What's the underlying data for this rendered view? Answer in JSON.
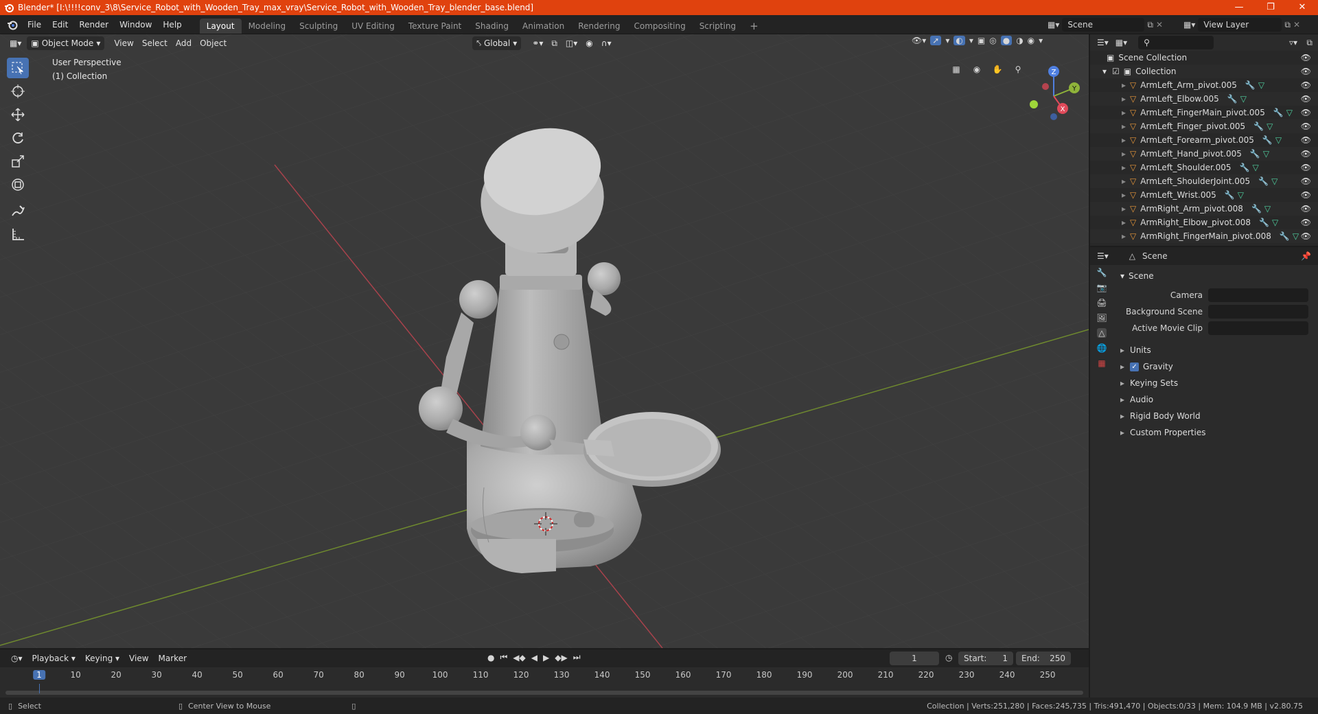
{
  "titlebar": {
    "title": "Blender* [I:\\!!!!conv_3\\8\\Service_Robot_with_Wooden_Tray_max_vray\\Service_Robot_with_Wooden_Tray_blender_base.blend]",
    "controls": [
      "minimize-icon",
      "maximize-icon",
      "close-icon"
    ]
  },
  "topbar": {
    "menus": [
      "File",
      "Edit",
      "Render",
      "Window",
      "Help"
    ],
    "workspaces": [
      "Layout",
      "Modeling",
      "Sculpting",
      "UV Editing",
      "Texture Paint",
      "Shading",
      "Animation",
      "Rendering",
      "Compositing",
      "Scripting"
    ],
    "active_workspace": "Layout",
    "scene": "Scene",
    "view_layer": "View Layer"
  },
  "viewport": {
    "mode": "Object Mode",
    "menus": [
      "View",
      "Select",
      "Add",
      "Object"
    ],
    "transform_orientation": "Global",
    "perspective_label": "User Perspective",
    "collection_label": "(1) Collection",
    "gizmo_axes": [
      "Z",
      "Y",
      "X"
    ],
    "tools": [
      "select-box-icon",
      "cursor-icon",
      "move-icon",
      "rotate-icon",
      "scale-icon",
      "transform-icon",
      "annotate-icon",
      "measure-icon"
    ],
    "colors": {
      "x_axis": "#e04a5a",
      "y_axis": "#8fb33a",
      "z_axis": "#4f7fe0",
      "accent": "#4772b3"
    }
  },
  "outliner": {
    "root": "Scene Collection",
    "collection": "Collection",
    "items": [
      "ArmLeft_Arm_pivot.005",
      "ArmLeft_Elbow.005",
      "ArmLeft_FingerMain_pivot.005",
      "ArmLeft_Finger_pivot.005",
      "ArmLeft_Forearm_pivot.005",
      "ArmLeft_Hand_pivot.005",
      "ArmLeft_Shoulder.005",
      "ArmLeft_ShoulderJoint.005",
      "ArmLeft_Wrist.005",
      "ArmRight_Arm_pivot.008",
      "ArmRight_Elbow_pivot.008",
      "ArmRight_FingerMain_pivot.008"
    ]
  },
  "properties": {
    "header": "Scene",
    "panel_title": "Scene",
    "fields": [
      {
        "label": "Camera",
        "value": ""
      },
      {
        "label": "Background Scene",
        "value": ""
      },
      {
        "label": "Active Movie Clip",
        "value": ""
      }
    ],
    "sections": [
      "Units",
      "Gravity",
      "Keying Sets",
      "Audio",
      "Rigid Body World",
      "Custom Properties"
    ],
    "gravity_checked": true
  },
  "timeline": {
    "menus": [
      "Playback",
      "Keying",
      "View",
      "Marker"
    ],
    "current_frame": "1",
    "start_label": "Start:",
    "start": "1",
    "end_label": "End:",
    "end": "250",
    "ruler": [
      "1",
      "10",
      "20",
      "30",
      "40",
      "50",
      "60",
      "70",
      "80",
      "90",
      "100",
      "110",
      "120",
      "130",
      "140",
      "150",
      "160",
      "170",
      "180",
      "190",
      "200",
      "210",
      "220",
      "230",
      "240",
      "250"
    ]
  },
  "statusbar": {
    "left_action": "Select",
    "middle_action": "Center View to Mouse",
    "stats": "Collection | Verts:251,280 | Faces:245,735 | Tris:491,470 | Objects:0/33 | Mem: 104.9 MB | v2.80.75"
  }
}
